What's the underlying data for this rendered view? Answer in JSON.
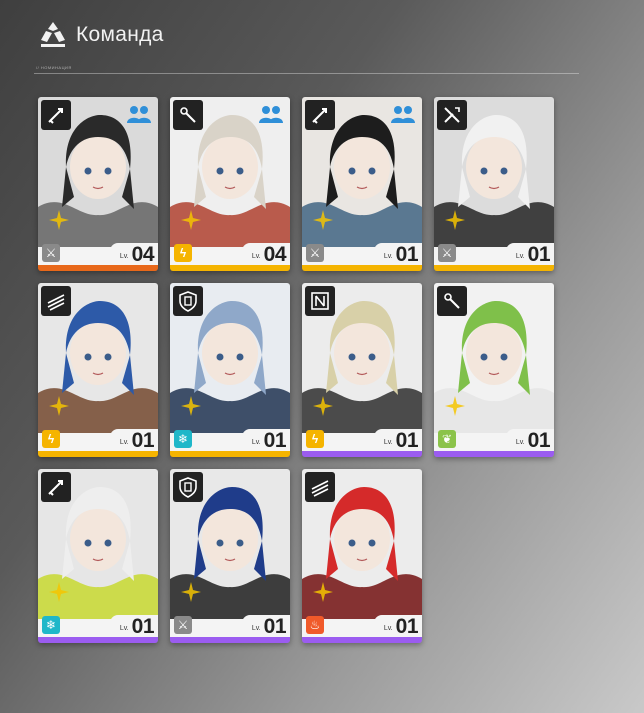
{
  "header": {
    "title": "Команда",
    "subtitle": "// НОМИНАЦИЯ"
  },
  "colors": {
    "orange": "#e8681a",
    "yellow": "#f5b400",
    "purple": "#9b5cf0",
    "elem_physical": "#8a8a8a",
    "elem_electric": "#f5b400",
    "elem_cryo": "#1fb7c9",
    "elem_nature": "#8bc34a",
    "elem_heat": "#f05a2a"
  },
  "level_prefix": "Lv.",
  "operators": [
    {
      "class_icon": "guard-icon",
      "element": "physical",
      "level": "04",
      "rarity_color": "orange",
      "team": true,
      "palette": [
        "#2a2a2a",
        "#6a6a6a",
        "#dadada"
      ]
    },
    {
      "class_icon": "caster-icon",
      "element": "electric",
      "level": "04",
      "rarity_color": "yellow",
      "team": true,
      "palette": [
        "#d9d3c8",
        "#b34a3a",
        "#efefef"
      ]
    },
    {
      "class_icon": "guard-icon",
      "element": "physical",
      "level": "01",
      "rarity_color": "yellow",
      "team": true,
      "palette": [
        "#1d1d1d",
        "#4a6b88",
        "#e9e6e2"
      ]
    },
    {
      "class_icon": "vanguard-icon",
      "element": "physical",
      "level": "01",
      "rarity_color": "yellow",
      "team": false,
      "palette": [
        "#f1f1f1",
        "#2f2f2f",
        "#dcdcdc"
      ]
    },
    {
      "class_icon": "striker-icon",
      "element": "electric",
      "level": "01",
      "rarity_color": "yellow",
      "team": false,
      "palette": [
        "#2d5aa8",
        "#7a5138",
        "#e7e7e7"
      ]
    },
    {
      "class_icon": "defender-icon",
      "element": "cryo",
      "level": "01",
      "rarity_color": "yellow",
      "team": false,
      "palette": [
        "#8fa8c9",
        "#2b3e5a",
        "#e8ecf1"
      ]
    },
    {
      "class_icon": "supporter-icon",
      "element": "electric",
      "level": "01",
      "rarity_color": "purple",
      "team": false,
      "palette": [
        "#d8d0a8",
        "#3a3a3a",
        "#ececec"
      ]
    },
    {
      "class_icon": "caster-icon",
      "element": "nature",
      "level": "01",
      "rarity_color": "purple",
      "team": false,
      "palette": [
        "#7fc04a",
        "#e6e6e6",
        "#f2f2f2"
      ]
    },
    {
      "class_icon": "guard-icon",
      "element": "cryo",
      "level": "01",
      "rarity_color": "purple",
      "team": false,
      "palette": [
        "#eeeeee",
        "#c9d93a",
        "#e6e6e6"
      ]
    },
    {
      "class_icon": "defender-icon",
      "element": "physical",
      "level": "01",
      "rarity_color": "purple",
      "team": false,
      "palette": [
        "#1f3c8a",
        "#2a2a2a",
        "#e8e8e8"
      ]
    },
    {
      "class_icon": "striker-icon",
      "element": "heat",
      "level": "01",
      "rarity_color": "purple",
      "team": false,
      "palette": [
        "#d52a2a",
        "#7a1e1e",
        "#ececec"
      ]
    }
  ]
}
